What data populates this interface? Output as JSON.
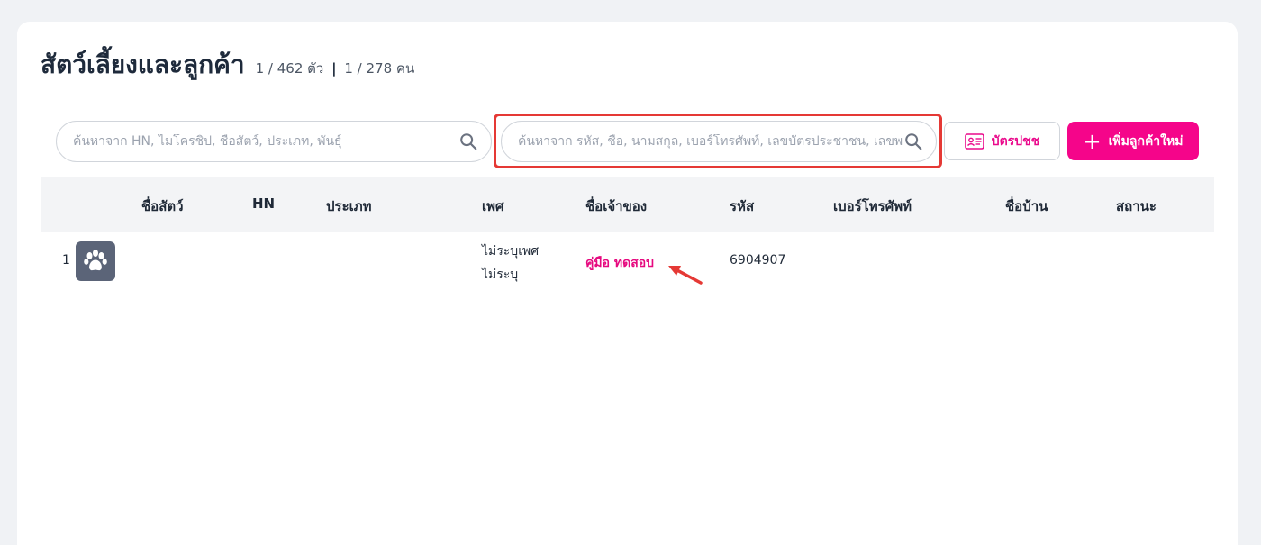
{
  "page": {
    "title": "สัตว์เลี้ยงและลูกค้า",
    "pet_count": "1 / 462 ตัว",
    "separator": "|",
    "customer_count": "1 / 278 คน"
  },
  "search": {
    "pet_placeholder": "ค้นหาจาก HN, ไมโครชิป, ชื่อสัตว์, ประเภท, พันธุ์",
    "customer_placeholder": "ค้นหาจาก รหัส, ชื่อ, นามสกุล, เบอร์โทรศัพท์, เลขบัตรประชาชน, เลขพาสปอร์ต"
  },
  "buttons": {
    "id_card": "บัตรปชช",
    "add_customer": "เพิ่มลูกค้าใหม่"
  },
  "table": {
    "columns": [
      "ชื่อสัตว์",
      "HN",
      "ประเภท",
      "เพศ",
      "ชื่อเจ้าของ",
      "รหัส",
      "เบอร์โทรศัพท์",
      "ชื่อบ้าน",
      "สถานะ"
    ],
    "rows": [
      {
        "index": "1",
        "pet_name": "",
        "hn": "",
        "type": "",
        "sex": "ไม่ระบุเพศ",
        "sterilized": "ไม่ระบุ",
        "owner": "คู่มือ ทดสอบ",
        "code": "6904907",
        "phone": "",
        "house_name": "",
        "status": ""
      }
    ]
  },
  "colors": {
    "accent": "#f5058a",
    "highlight": "#e53935",
    "avatar_bg": "#5b6478"
  },
  "icons": [
    "search-icon",
    "id-card-icon",
    "plus-icon",
    "paw-icon"
  ]
}
